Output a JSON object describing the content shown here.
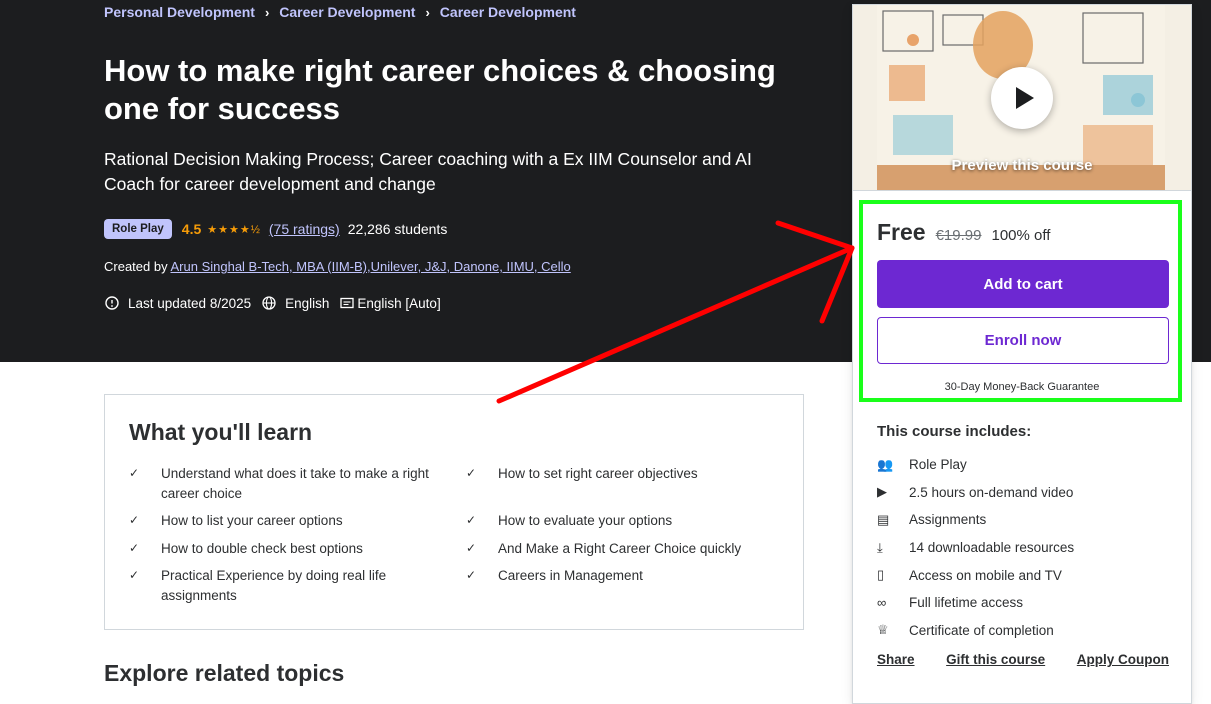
{
  "breadcrumbs": [
    "Personal Development",
    "Career Development",
    "Career Development"
  ],
  "course": {
    "title": "How to make right career choices & choosing one for success",
    "subtitle": "Rational Decision Making Process; Career coaching with a Ex IIM Counselor and AI Coach for career development and change",
    "badge": "Role Play",
    "rating": "4.5",
    "stars": "★★★★½",
    "ratings_text": "(75 ratings)",
    "students": "22,286 students",
    "created_prefix": "Created by",
    "instructor": "Arun Singhal B-Tech, MBA (IIM-B),Unilever, J&J, Danone, IIMU, Cello",
    "last_updated": "Last updated 8/2025",
    "language": "English",
    "captions": "English [Auto]"
  },
  "learn": {
    "heading": "What you'll learn",
    "items": [
      "Understand what does it take to make a right career choice",
      "How to set right career objectives",
      "How to list your career options",
      "How to evaluate your options",
      "How to double check best options",
      "And Make a Right Career Choice quickly",
      "Practical Experience by doing real life assignments",
      "Careers in Management"
    ]
  },
  "related_heading": "Explore related topics",
  "sidebar": {
    "preview_label": "Preview this course",
    "price": "Free",
    "original_price": "€19.99",
    "discount": "100% off",
    "add_to_cart": "Add to cart",
    "enroll_now": "Enroll now",
    "guarantee": "30-Day Money-Back Guarantee",
    "includes_title": "This course includes:",
    "includes": [
      {
        "icon": "role-play-icon",
        "label": "Role Play"
      },
      {
        "icon": "video-icon",
        "label": "2.5 hours on-demand video"
      },
      {
        "icon": "assignment-icon",
        "label": "Assignments"
      },
      {
        "icon": "download-icon",
        "label": "14 downloadable resources"
      },
      {
        "icon": "mobile-icon",
        "label": "Access on mobile and TV"
      },
      {
        "icon": "infinity-icon",
        "label": "Full lifetime access"
      },
      {
        "icon": "trophy-icon",
        "label": "Certificate of completion"
      }
    ],
    "links": [
      "Share",
      "Gift this course",
      "Apply Coupon"
    ]
  },
  "colors": {
    "hero_bg": "#1c1d1f",
    "accent_purple": "#6d28d2",
    "link_lavender": "#c0c4fc",
    "star_orange": "#f69c08",
    "highlight_green": "#1aff1a",
    "annotation_red": "#ff0000"
  }
}
